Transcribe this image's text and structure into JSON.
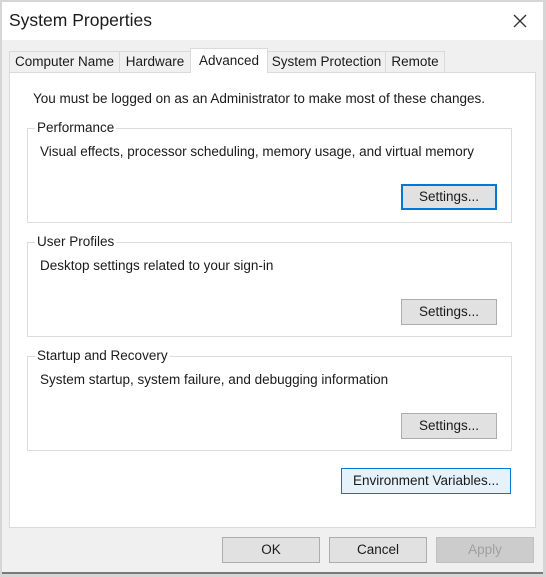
{
  "window": {
    "title": "System Properties",
    "close_icon": "close-icon"
  },
  "tabs": [
    {
      "label": "Computer Name",
      "active": false
    },
    {
      "label": "Hardware",
      "active": false
    },
    {
      "label": "Advanced",
      "active": true
    },
    {
      "label": "System Protection",
      "active": false
    },
    {
      "label": "Remote",
      "active": false
    }
  ],
  "panel": {
    "note": "You must be logged on as an Administrator to make most of these changes.",
    "groups": [
      {
        "label": "Performance",
        "description": "Visual effects, processor scheduling, memory usage, and virtual memory",
        "button_label": "Settings..."
      },
      {
        "label": "User Profiles",
        "description": "Desktop settings related to your sign-in",
        "button_label": "Settings..."
      },
      {
        "label": "Startup and Recovery",
        "description": "System startup, system failure, and debugging information",
        "button_label": "Settings..."
      }
    ],
    "env_button_label": "Environment Variables..."
  },
  "footer": {
    "ok_label": "OK",
    "cancel_label": "Cancel",
    "apply_label": "Apply"
  },
  "colors": {
    "accent": "#0078d7",
    "hover_fill": "#e5f1fb",
    "dialog_bg": "#f0f0f0",
    "panel_bg": "#ffffff"
  }
}
